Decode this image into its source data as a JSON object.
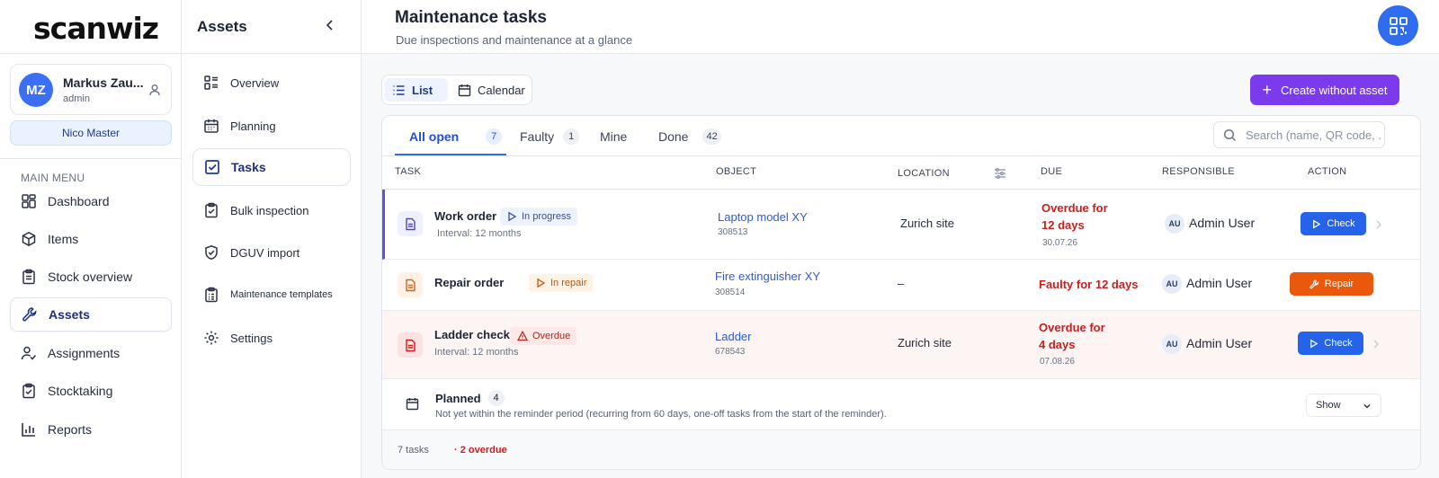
{
  "app": {
    "logo": "scanwiz"
  },
  "user": {
    "initials": "MZ",
    "name": "Markus Zau...",
    "role": "admin",
    "org": "Nico Master"
  },
  "sidebar": {
    "heading": "MAIN MENU",
    "items": [
      {
        "label": "Dashboard",
        "icon": "dashboard-icon"
      },
      {
        "label": "Items",
        "icon": "cube-icon"
      },
      {
        "label": "Stock overview",
        "icon": "clipboard-icon"
      },
      {
        "label": "Assets",
        "icon": "wrench-icon",
        "active": true
      },
      {
        "label": "Assignments",
        "icon": "user-check-icon"
      },
      {
        "label": "Stocktaking",
        "icon": "clipboard-check-icon"
      },
      {
        "label": "Reports",
        "icon": "bar-chart-icon"
      }
    ]
  },
  "subnav": {
    "title": "Assets",
    "items": [
      {
        "label": "Overview"
      },
      {
        "label": "Planning"
      },
      {
        "label": "Tasks",
        "active": true
      },
      {
        "label": "Bulk inspection"
      },
      {
        "label": "DGUV import"
      },
      {
        "label": "Maintenance templates"
      },
      {
        "label": "Settings"
      }
    ]
  },
  "header": {
    "title": "Maintenance tasks",
    "subtitle": "Due inspections and maintenance at a glance"
  },
  "toolbar": {
    "list_label": "List",
    "calendar_label": "Calendar",
    "create_label": "Create without asset"
  },
  "tabs": [
    {
      "label": "All open",
      "count": "7",
      "active": true
    },
    {
      "label": "Faulty",
      "count": "1"
    },
    {
      "label": "Mine",
      "count": ""
    },
    {
      "label": "Done",
      "count": "42"
    }
  ],
  "search": {
    "placeholder": "Search (name, QR code, ...)"
  },
  "columns": {
    "task": "TASK",
    "object": "OBJECT",
    "location": "LOCATION",
    "due": "DUE",
    "responsible": "RESPONSIBLE",
    "action": "ACTION"
  },
  "rows": [
    {
      "task": "Work order",
      "status": "In progress",
      "interval": "Interval: 12 months",
      "object": "Laptop model XY",
      "object_id": "308513",
      "location": "Zurich site",
      "due_line1": "Overdue for",
      "due_line2": "12 days",
      "due_date": "30.07.26",
      "resp_initials": "AU",
      "resp_name": "Admin User",
      "action": "Check"
    },
    {
      "task": "Repair order",
      "status": "In repair",
      "interval": "",
      "object": "Fire extinguisher XY",
      "object_id": "308514",
      "location": "–",
      "due_line1": "Faulty for 12 days",
      "due_line2": "",
      "due_date": "",
      "resp_initials": "AU",
      "resp_name": "Admin User",
      "action": "Repair"
    },
    {
      "task": "Ladder check",
      "status": "Overdue",
      "interval": "Interval: 12 months",
      "object": "Ladder",
      "object_id": "678543",
      "location": "Zurich site",
      "due_line1": "Overdue for",
      "due_line2": "4 days",
      "due_date": "07.08.26",
      "resp_initials": "AU",
      "resp_name": "Admin User",
      "action": "Check"
    }
  ],
  "planned": {
    "title": "Planned",
    "count": "4",
    "description": "Not yet within the reminder period (recurring from 60 days, one-off tasks from the start of the reminder).",
    "show_label": "Show"
  },
  "footer": {
    "count": "7 tasks",
    "overdue": "· 2 overdue"
  },
  "colors": {
    "primary": "#2563eb",
    "purple": "#7c3aed",
    "orange": "#ea580c",
    "danger": "#c81e1e"
  }
}
